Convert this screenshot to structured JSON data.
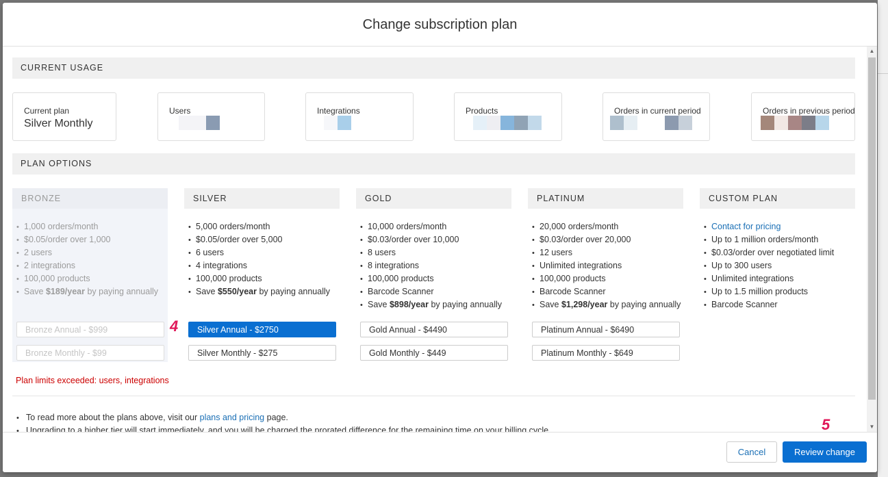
{
  "modal": {
    "title": "Change subscription plan"
  },
  "usage": {
    "heading": "CURRENT USAGE",
    "current_plan": {
      "label": "Current plan",
      "value": "Silver Monthly"
    },
    "cards": [
      {
        "label": "Users",
        "blocks": [
          "#f4f4f7",
          "#f4f4f7",
          "#8a9bb2"
        ]
      },
      {
        "label": "Integrations",
        "blocks": [
          "#f6f7fa",
          "#a9cfea"
        ]
      },
      {
        "label": "Products",
        "blocks": [
          "#e5f0f8",
          "#eeeef2",
          "#86b5dc",
          "#90a3b5",
          "#c2d9ea"
        ]
      },
      {
        "label": "Orders in current period",
        "blocks": [
          "#aebfcd",
          "#e6eef3",
          "#ffffff",
          "#ffffff",
          "#8c9aaf",
          "#c7d0da"
        ]
      },
      {
        "label": "Orders in previous period",
        "blocks": [
          "#a4877a",
          "#f2e8e4",
          "#a88685",
          "#7c7d88",
          "#b7d6ea"
        ]
      }
    ]
  },
  "plans": {
    "heading": "PLAN OPTIONS",
    "columns": [
      {
        "name": "BRONZE",
        "features": [
          "1,000 orders/month",
          "$0.05/order over 1,000",
          "2 users",
          "2 integrations",
          "100,000 products"
        ],
        "save": {
          "prefix": "Save ",
          "amount": "$189/year",
          "suffix": " by paying annually"
        },
        "options": [
          "Bronze Annual - $999",
          "Bronze Monthly - $99"
        ]
      },
      {
        "name": "SILVER",
        "features": [
          "5,000 orders/month",
          "$0.05/order over 5,000",
          "6 users",
          "4 integrations",
          "100,000 products"
        ],
        "save": {
          "prefix": "Save ",
          "amount": "$550/year",
          "suffix": " by paying annually"
        },
        "options": [
          "Silver Annual - $2750",
          "Silver Monthly - $275"
        ]
      },
      {
        "name": "GOLD",
        "features": [
          "10,000 orders/month",
          "$0.03/order over 10,000",
          "8 users",
          "8 integrations",
          "100,000 products",
          "Barcode Scanner"
        ],
        "save": {
          "prefix": "Save ",
          "amount": "$898/year",
          "suffix": " by paying annually"
        },
        "options": [
          "Gold Annual - $4490",
          "Gold Monthly - $449"
        ]
      },
      {
        "name": "PLATINUM",
        "features": [
          "20,000 orders/month",
          "$0.03/order over 20,000",
          "12 users",
          "Unlimited integrations",
          "100,000 products",
          "Barcode Scanner"
        ],
        "save": {
          "prefix": "Save ",
          "amount": "$1,298/year",
          "suffix": " by paying annually"
        },
        "options": [
          "Platinum Annual - $6490",
          "Platinum Monthly - $649"
        ]
      },
      {
        "name": "CUSTOM PLAN",
        "link": "Contact for pricing",
        "features": [
          "Up to 1 million orders/month",
          "$0.03/order over negotiated limit",
          "Up to 300 users",
          "Unlimited integrations",
          "Up to 1.5 million products",
          "Barcode Scanner"
        ]
      }
    ],
    "warning": "Plan limits exceeded: users, integrations"
  },
  "notes": {
    "line1_prefix": "To read more about the plans above, visit our ",
    "line1_link": "plans and pricing",
    "line1_suffix": " page.",
    "line2": "Upgrading to a higher tier will start immediately, and you will be charged the prorated difference for the remaining time on your billing cycle."
  },
  "footer": {
    "cancel": "Cancel",
    "review": "Review change"
  },
  "annotations": {
    "step4": "4",
    "step5": "5"
  },
  "colors": {
    "accent": "#0a6fd1",
    "link": "#1a6fb5",
    "warning": "#cc0000",
    "annotation": "#e0195a"
  }
}
